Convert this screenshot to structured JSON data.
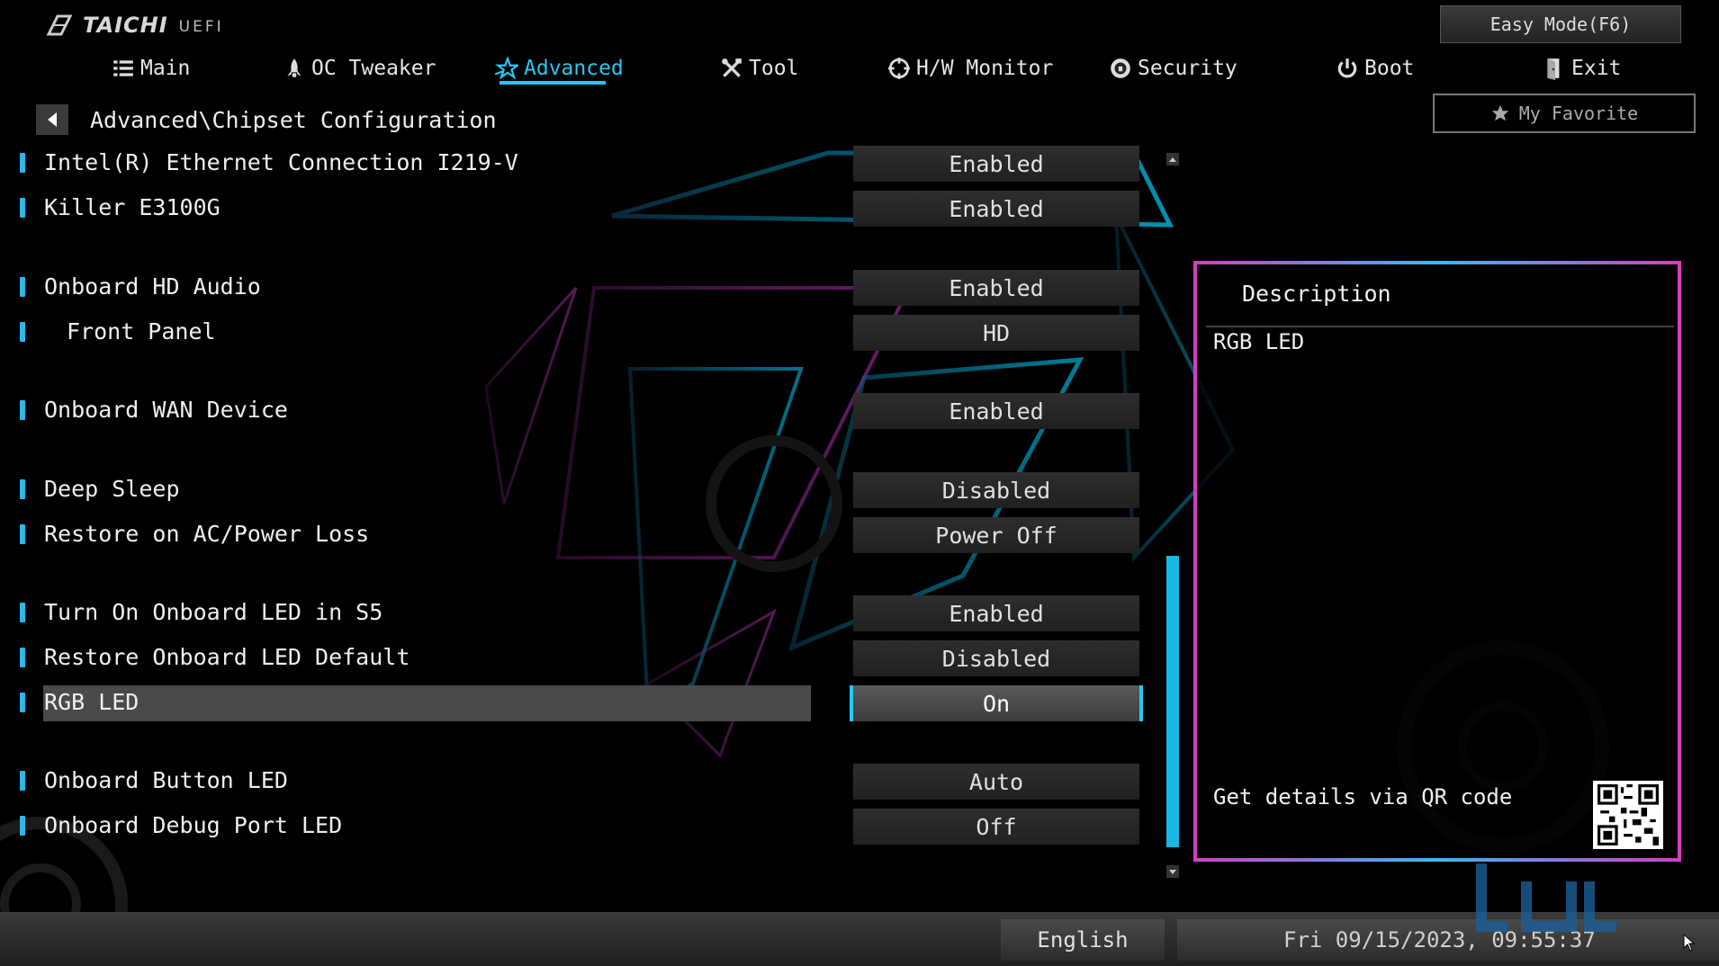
{
  "header": {
    "brand": "TAICHI",
    "uefi": "UEFI",
    "easy_mode": "Easy Mode(F6)",
    "favorite": "My Favorite"
  },
  "nav": [
    {
      "label": "Main",
      "icon": "list-icon"
    },
    {
      "label": "OC Tweaker",
      "icon": "rocket-icon"
    },
    {
      "label": "Advanced",
      "icon": "star-icon",
      "active": true
    },
    {
      "label": "Tool",
      "icon": "tools-icon"
    },
    {
      "label": "H/W Monitor",
      "icon": "crosshair-icon"
    },
    {
      "label": "Security",
      "icon": "shield-icon"
    },
    {
      "label": "Boot",
      "icon": "power-icon"
    },
    {
      "label": "Exit",
      "icon": "exit-door-icon"
    }
  ],
  "breadcrumb": "Advanced\\Chipset Configuration",
  "settings": [
    {
      "label": "Intel(R) Ethernet Connection I219-V",
      "value": "Enabled"
    },
    {
      "label": "Killer E3100G",
      "value": "Enabled"
    },
    {
      "label": "Onboard HD Audio",
      "value": "Enabled"
    },
    {
      "label": "Front Panel",
      "value": "HD"
    },
    {
      "label": "Onboard WAN Device",
      "value": "Enabled"
    },
    {
      "label": "Deep Sleep",
      "value": "Disabled"
    },
    {
      "label": "Restore on AC/Power Loss",
      "value": "Power Off"
    },
    {
      "label": "Turn On Onboard LED in S5",
      "value": "Enabled"
    },
    {
      "label": "Restore Onboard LED Default",
      "value": "Disabled"
    },
    {
      "label": "RGB LED",
      "value": "On"
    },
    {
      "label": "Onboard Button LED",
      "value": "Auto"
    },
    {
      "label": "Onboard Debug Port LED",
      "value": "Off"
    }
  ],
  "description": {
    "title": "Description",
    "text": "RGB LED",
    "qr_text": "Get details via QR code"
  },
  "footer": {
    "language": "English",
    "datetime": "Fri 09/15/2023, 09:55:37"
  },
  "colors": {
    "accent": "#28c8f0",
    "panel_border_pink": "#d040c0"
  }
}
